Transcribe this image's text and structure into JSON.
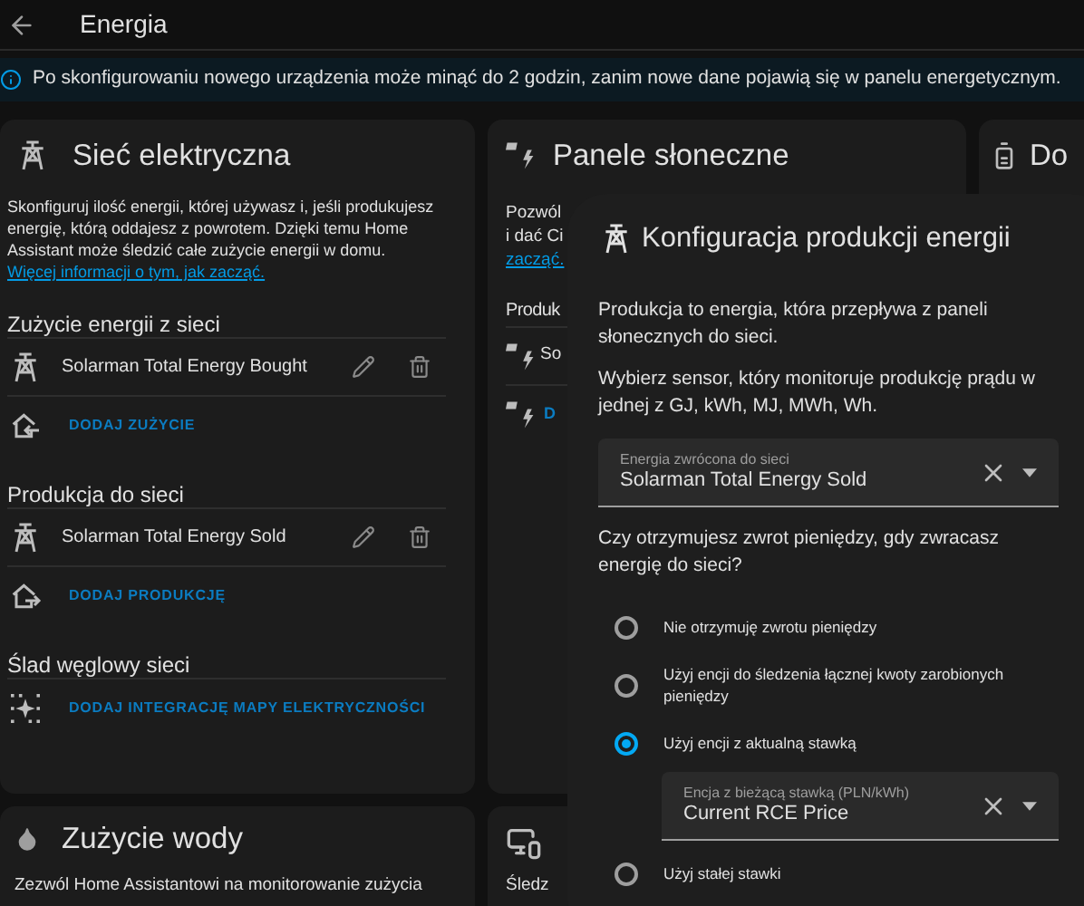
{
  "header": {
    "title": "Energia"
  },
  "info_banner": "Po skonfigurowaniu nowego urządzenia może minąć do 2 godzin, zanim nowe dane pojawią się w panelu energetycznym.",
  "grid_card": {
    "title": "Sieć elektryczna",
    "description": "Skonfiguruj ilość energii, której używasz i, jeśli produkujesz energię, którą oddajesz z powrotem. Dzięki temu Home Assistant może śledzić całe zużycie energii w domu.",
    "link": "Więcej informacji o tym, jak zacząć.",
    "sections": [
      {
        "kind": "consumption",
        "heading": "Zużycie energii z sieci",
        "rows": [
          "Solarman Total Energy Bought"
        ],
        "add": "DODAJ ZUŻYCIE"
      },
      {
        "kind": "production",
        "heading": "Produkcja do sieci",
        "rows": [
          "Solarman Total Energy Sold"
        ],
        "add": "DODAJ PRODUKCJĘ"
      },
      {
        "kind": "carbon",
        "heading": "Ślad węglowy sieci",
        "add": "DODAJ INTEGRACJĘ MAPY ELEKTRYCZNOŚCI"
      }
    ]
  },
  "solar_card": {
    "title": "Panele słoneczne",
    "description_lines": [
      "Pozwól",
      "i dać Ci"
    ],
    "link": "zacząć.",
    "heading": "Produk",
    "row": "So",
    "add": "D"
  },
  "battery_card": {
    "title": "Do"
  },
  "water_card": {
    "title": "Zużycie wody",
    "description": "Zezwól Home Assistantowi na monitorowanie zużycia"
  },
  "device_card": {
    "description": "Śledz"
  },
  "dialog": {
    "title": "Konfiguracja produkcji energii",
    "paragraphs": [
      "Produkcja to energia, która przepływa z paneli słonecznych do sieci.",
      "Wybierz sensor, który monitoruje produkcję prądu w jednej z GJ, kWh, MJ, MWh, Wh."
    ],
    "sensor_field": {
      "label": "Energia zwrócona do sieci",
      "value": "Solarman Total Energy Sold"
    },
    "question": "Czy otrzymujesz zwrot pieniędzy, gdy zwracasz energię do sieci?",
    "options": [
      {
        "label": "Nie otrzymuję zwrotu pieniędzy",
        "selected": false
      },
      {
        "label": "Użyj encji do śledzenia łącznej kwoty zarobionych pieniędzy",
        "selected": false
      },
      {
        "label": "Użyj encji z aktualną stawką",
        "selected": true,
        "field": {
          "label": "Encja z bieżącą stawką (PLN/kWh)",
          "value": "Current RCE Price"
        }
      },
      {
        "label": "Użyj stałej stawki",
        "selected": false
      }
    ]
  }
}
